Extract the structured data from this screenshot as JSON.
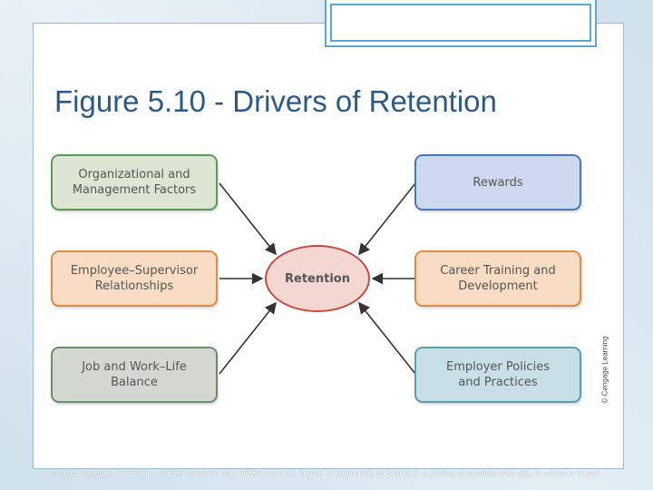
{
  "title": "Figure 5.10 - Drivers of Retention",
  "diagram": {
    "center": "Retention",
    "left_boxes": [
      "Organizational and\nManagement Factors",
      "Employee–Supervisor\nRelationships",
      "Job and Work–Life\nBalance"
    ],
    "right_boxes": [
      "Rewards",
      "Career Training and\nDevelopment",
      "Employer Policies\nand Practices"
    ]
  },
  "vertical_credit": "© Cengage Learning",
  "footer": "© 2014 Cengage Learning. All rights reserved. May not be scanned, copied or duplicated, or posted to a publicly accessible Web site, in whole or in part."
}
